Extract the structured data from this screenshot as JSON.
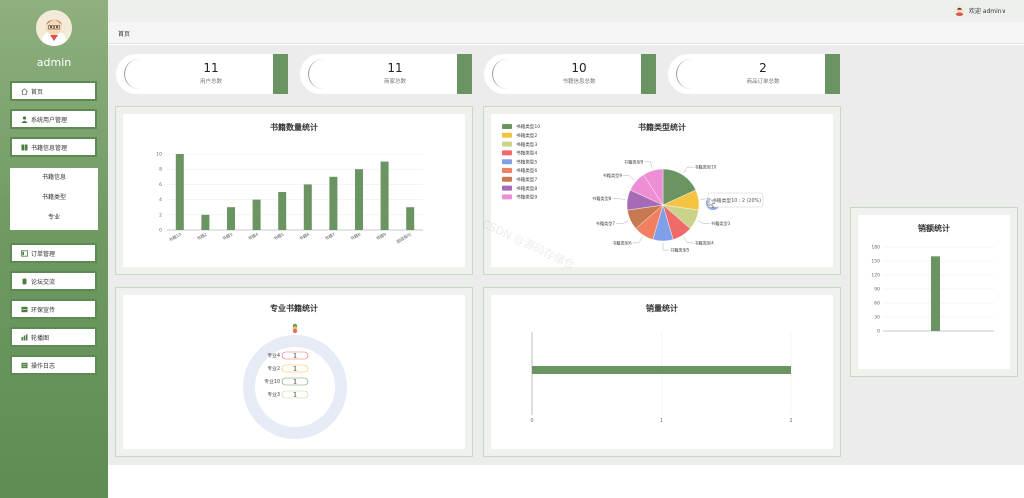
{
  "user": {
    "name": "admin",
    "welcome": "欢迎 admin∨"
  },
  "breadcrumb": "首页",
  "menu": {
    "items": [
      {
        "label": "首页",
        "icon": "home-icon"
      },
      {
        "label": "系统用户管理",
        "icon": "user-icon"
      },
      {
        "label": "书籍信息管理",
        "icon": "book-icon"
      },
      {
        "label": "订单管理",
        "icon": "order-icon"
      },
      {
        "label": "论坛交流",
        "icon": "forum-icon"
      },
      {
        "label": "环保宣传",
        "icon": "promo-icon"
      },
      {
        "label": "轮播图",
        "icon": "carousel-icon"
      },
      {
        "label": "操作日志",
        "icon": "log-icon"
      }
    ],
    "submenu": [
      "书籍信息",
      "书籍类型",
      "专业"
    ]
  },
  "stats": [
    {
      "value": "11",
      "label": "用户总数"
    },
    {
      "value": "11",
      "label": "商家总数"
    },
    {
      "value": "10",
      "label": "书籍信息总数"
    },
    {
      "value": "2",
      "label": "商品订单总数"
    }
  ],
  "colors": {
    "accent": "#6a9461",
    "sidebar": "#6f9a63"
  },
  "watermark": "CSDN @源码存储仓",
  "chart_data": [
    {
      "type": "bar",
      "title": "书籍数量统计",
      "categories": [
        "书籍10",
        "书籍2",
        "书籍3",
        "书籍4",
        "书籍5",
        "书籍6",
        "书籍7",
        "书籍8",
        "书籍9",
        "超级帮忙"
      ],
      "values": [
        10,
        2,
        3,
        4,
        5,
        6,
        7,
        8,
        9,
        3
      ],
      "ylim": [
        0,
        10
      ],
      "yticks": [
        0,
        2,
        4,
        6,
        8,
        10
      ],
      "grid": true
    },
    {
      "type": "pie",
      "title": "书籍类型统计",
      "categories": [
        "书籍类型10",
        "书籍类型2",
        "书籍类型3",
        "书籍类型4",
        "书籍类型5",
        "书籍类型6",
        "书籍类型7",
        "书籍类型8",
        "书籍类型9",
        "书籍类型9"
      ],
      "values": [
        2,
        1,
        1,
        1,
        1,
        1,
        1,
        1,
        1,
        1
      ],
      "colors": [
        "#6a9461",
        "#f5c342",
        "#c9d38a",
        "#f06a6a",
        "#7fa0e8",
        "#f28060",
        "#c77a52",
        "#a56bb7",
        "#ee8fd5",
        "#ee8fd5"
      ],
      "legend": [
        "书籍类型10",
        "书籍类型2",
        "书籍类型3",
        "书籍类型4",
        "书籍类型5",
        "书籍类型6",
        "书籍类型7",
        "书籍类型8",
        "书籍类型9"
      ],
      "legend_position": "left",
      "tooltip": "书籍类型10 : 2 (20%)"
    },
    {
      "type": "pie",
      "title": "专业书籍统计",
      "categories": [
        "专业4",
        "专业2",
        "专业10",
        "专业3"
      ],
      "values": [
        1,
        1,
        1,
        1
      ]
    },
    {
      "type": "bar",
      "title": "销量统计",
      "orientation": "horizontal",
      "values": [
        2
      ],
      "xlim": [
        0,
        2
      ],
      "xticks": [
        0,
        1,
        2
      ]
    },
    {
      "type": "bar",
      "title": "销额统计",
      "values": [
        160
      ],
      "ylim": [
        0,
        180
      ],
      "yticks": [
        0,
        30,
        60,
        90,
        120,
        150,
        180
      ]
    }
  ]
}
